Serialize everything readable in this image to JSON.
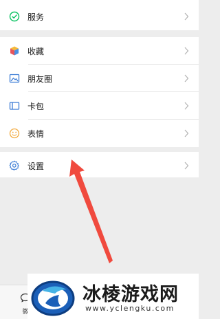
{
  "menu": {
    "services": {
      "label": "服务",
      "icon": "services-check-icon"
    },
    "favorites": {
      "label": "收藏",
      "icon": "favorites-cube-icon"
    },
    "moments": {
      "label": "朋友圈",
      "icon": "moments-image-icon"
    },
    "cards": {
      "label": "卡包",
      "icon": "card-wallet-icon"
    },
    "stickers": {
      "label": "表情",
      "icon": "sticker-smile-icon"
    },
    "settings": {
      "label": "设置",
      "icon": "settings-gear-icon"
    }
  },
  "tabbar": {
    "wechat_label": "微"
  },
  "watermark": {
    "title": "冰棱游戏网",
    "url": "www.yclengku.com"
  },
  "colors": {
    "background": "#ededed",
    "services_green": "#07c160",
    "annotation_arrow": "#f04a3e",
    "icon_blue": "#3a7bd5"
  }
}
